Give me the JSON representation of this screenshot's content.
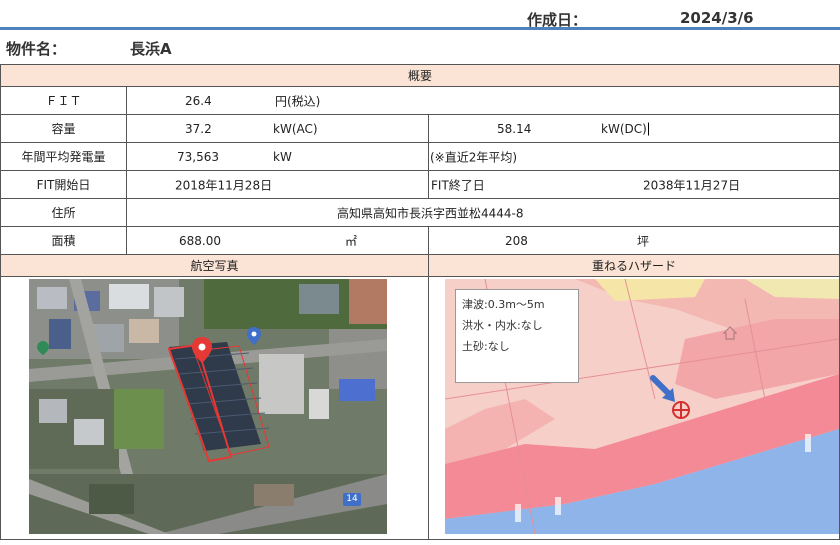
{
  "header": {
    "date_label": "作成日：",
    "date_value": "2024/3/6",
    "property_label": "物件名：",
    "property_value": "長浜A"
  },
  "overview": {
    "title": "概要",
    "fit_label": "ＦＩＴ",
    "fit_value": "26.4",
    "fit_unit": "円(税込)",
    "capacity_label": "容量",
    "capacity_ac_value": "37.2",
    "capacity_ac_unit": "kW(AC)",
    "capacity_dc_value": "58.14",
    "capacity_dc_unit": "kW(DC)",
    "annual_gen_label": "年間平均発電量",
    "annual_gen_value": "73,563",
    "annual_gen_unit": "kW",
    "annual_gen_note": "(※直近2年平均)",
    "fit_start_label": "FIT開始日",
    "fit_start_value": "2018年11月28日",
    "fit_end_label": "FIT終了日",
    "fit_end_value": "2038年11月27日",
    "address_label": "住所",
    "address_value": "高知県高知市長浜字西並松4444-8",
    "area_label": "面積",
    "area_m2_value": "688.00",
    "area_m2_unit": "㎡",
    "area_tsubo_value": "208",
    "area_tsubo_unit": "坪"
  },
  "photos": {
    "aerial_title": "航空写真",
    "hazard_title": "重ねるハザード",
    "aerial_road_badge": "14",
    "hazard_legend": {
      "tsunami": "津波:0.3m～5m",
      "flood": "洪水・内水:なし",
      "landslide": "土砂:なし"
    }
  },
  "colors": {
    "header_fill": "#fbe4d5",
    "top_rule": "#4f81bd",
    "marker_red": "#e53935",
    "arrow_blue": "#3f6fc8",
    "sea_blue": "#8fb4ea"
  }
}
